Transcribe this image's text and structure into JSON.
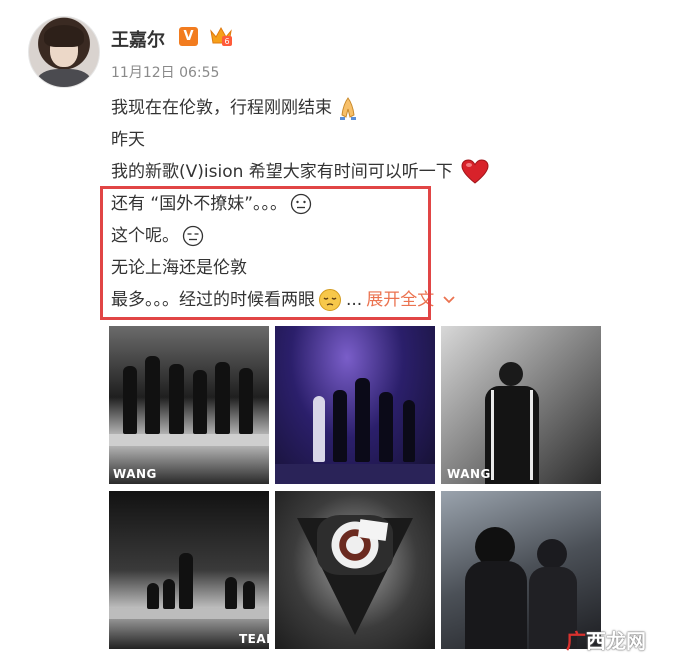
{
  "user": {
    "name": "王嘉尔",
    "verified_badge": "V",
    "time": "11月12日 06:55"
  },
  "post": {
    "lines": [
      "我现在在伦敦，行程刚刚结束",
      "昨天",
      "我的新歌(V)ision 希望大家有时间可以听一下",
      "还有 “国外不撩妹”。。。",
      "这个呢。",
      "无论上海还是伦敦",
      "最多。。。经过的时候看两眼"
    ],
    "ellipsis": "...",
    "expand_label": "展开全文"
  },
  "photos": {
    "watermarks": [
      "WANG",
      "WANG",
      "TEAM"
    ]
  },
  "site_watermark": {
    "part1": "广",
    "part2": "西龙网"
  },
  "colors": {
    "highlight_border": "#e14545",
    "expand_link": "#eb7350",
    "verified": "#f27c1f"
  },
  "icons": [
    "verified-v-icon",
    "vip-crown-icon",
    "pray-hands-emoji",
    "red-heart-emoji",
    "neutral-face-emoji",
    "expressionless-face-emoji",
    "pensive-face-emoji",
    "chevron-down-icon"
  ]
}
